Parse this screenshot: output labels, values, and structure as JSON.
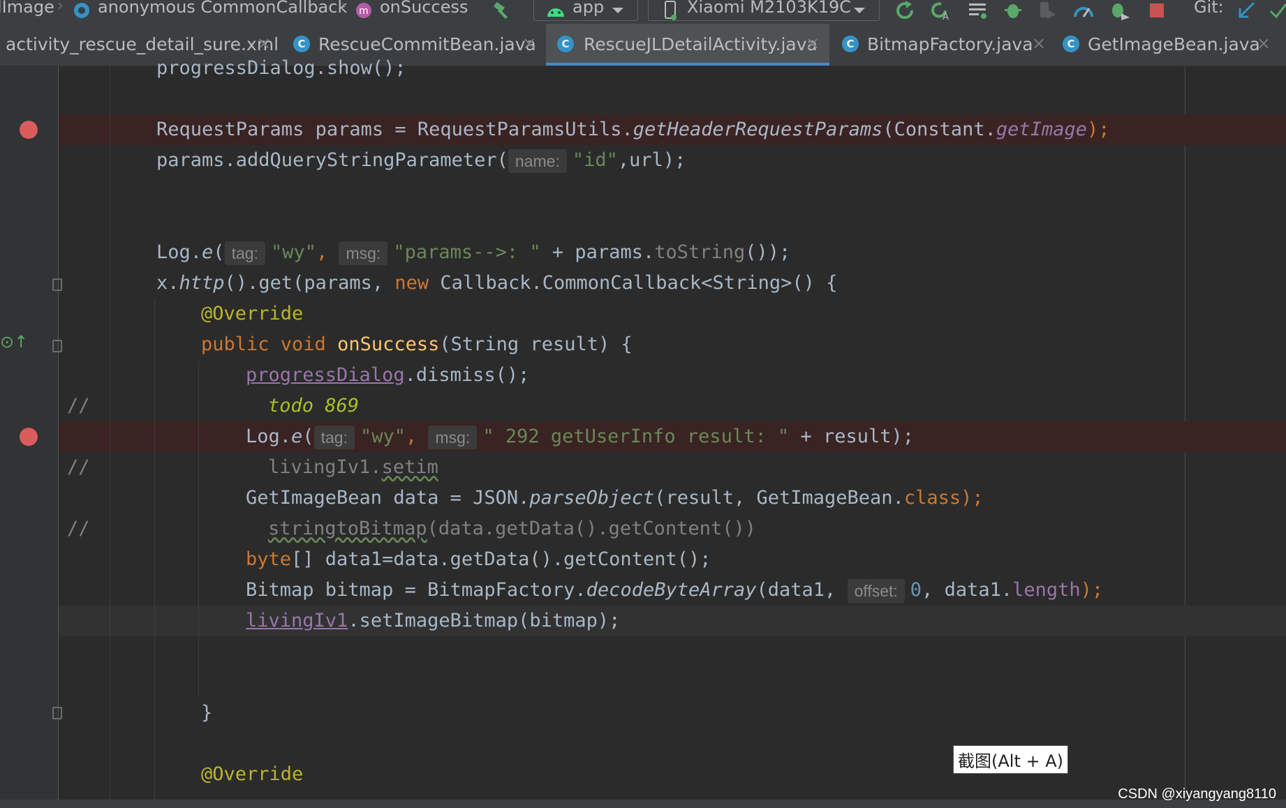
{
  "breadcrumb": {
    "items": [
      "lImage",
      "anonymous CommonCallback",
      "onSuccess"
    ],
    "icons": [
      "class-icon",
      "method-icon"
    ]
  },
  "toolbar": {
    "run_config": "app",
    "device": "Xiaomi M2103K19C",
    "git_label": "Git:"
  },
  "tabs": [
    {
      "label": "activity_rescue_detail_sure.xml",
      "badge": "",
      "active": false
    },
    {
      "label": "RescueCommitBean.java",
      "badge": "C",
      "active": false
    },
    {
      "label": "RescueJLDetailActivity.java",
      "badge": "C",
      "active": true
    },
    {
      "label": "BitmapFactory.java",
      "badge": "C",
      "active": false
    },
    {
      "label": "GetImageBean.java",
      "badge": "C",
      "active": false
    }
  ],
  "code": {
    "l0": "progressDialog.show();",
    "l2a": "RequestParams params = RequestParamsUtils.",
    "l2b": "getHeaderRequestParams",
    "l2c": "(Constant.",
    "l2d": "getImage",
    "l2e": ");",
    "l3a": "params.addQueryStringParameter(",
    "l3hint": "name:",
    "l3b": "\"id\"",
    "l3c": ",url);",
    "l6a": "Log.",
    "l6b": "e",
    "l6c": "(",
    "l6hint1": "tag:",
    "l6d": "\"wy\"",
    "l6e": ", ",
    "l6hint2": "msg:",
    "l6f": "\"params-->: \"",
    "l6g": " + params.",
    "l6h": "toString",
    "l6i": "());",
    "l7a": "x.",
    "l7b": "http",
    "l7c": "().get(params, ",
    "l7d": "new",
    "l7e": " Callback.CommonCallback<String>() {",
    "l8": "@Override",
    "l9a": "public void ",
    "l9b": "onSuccess",
    "l9c": "(String result) {",
    "l10a": "progressDialog",
    "l10b": ".dismiss();",
    "l11cmt": "//",
    "l11": "todo 869",
    "l12a": "Log.",
    "l12b": "e",
    "l12c": "(",
    "l12hint1": "tag:",
    "l12d": "\"wy\"",
    "l12e": ", ",
    "l12hint2": "msg:",
    "l12f": "\" 292 getUserInfo result: \"",
    "l12g": " + result);",
    "l13cmt": "//",
    "l13a": "livingIv1.",
    "l13b": "setim",
    "l14a": "GetImageBean data = JSON.",
    "l14b": "parseObject",
    "l14c": "(result, GetImageBean.",
    "l14d": "class",
    "l14e": ");",
    "l15cmt": "//",
    "l15a": "stringtoBitmap",
    "l15b": "(data.getData().getContent())",
    "l16a": "byte",
    "l16b": "[] data1=data.getData().getContent();",
    "l17a": "Bitmap bitmap = BitmapFactory.",
    "l17b": "decodeByteArray",
    "l17c": "(data1, ",
    "l17hint": "offset:",
    "l17d": "0",
    "l17e": ", data1.",
    "l17f": "length",
    "l17g": ");",
    "l18a": "livingIv1",
    "l18b": ".setImageBitmap(bitmap);",
    "l21": "}",
    "l23": "@Override"
  },
  "tooltip": "截图(Alt + A)",
  "watermark": "CSDN @xiyangyang8110",
  "colors": {
    "editor_bg": "#2b2b2b",
    "keyword": "#cc7832",
    "string": "#6a8759",
    "method_decl": "#ffc66d",
    "field": "#9876aa",
    "annotation": "#bbb529",
    "breakpoint": "#db5c5c",
    "active_tab_underline": "#4a88c7"
  }
}
